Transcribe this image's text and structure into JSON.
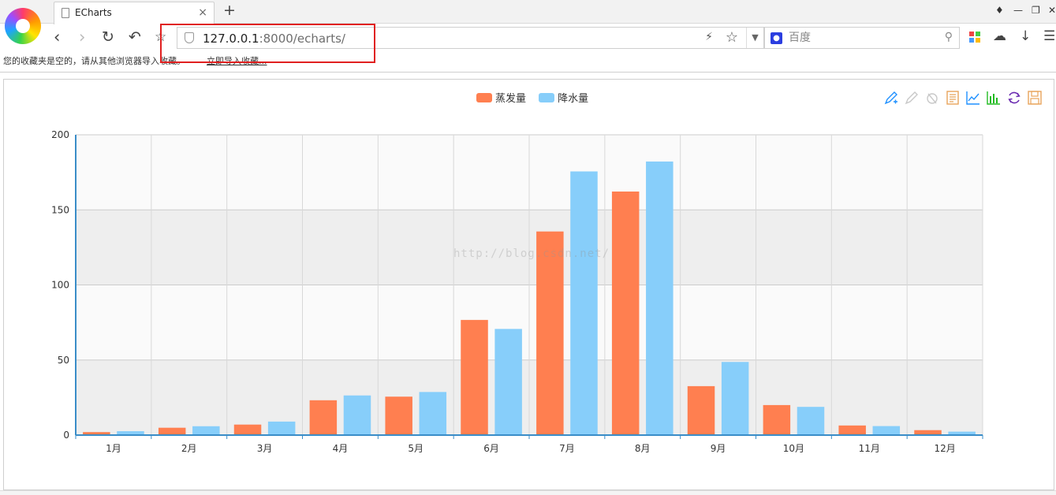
{
  "browser": {
    "tab_title": "ECharts",
    "tab_close": "×",
    "new_tab": "+",
    "url_host": "127.0.0.1",
    "url_rest": ":8000/echarts/",
    "search_placeholder": "百度",
    "search_engine_icon": "baidu-paw-icon"
  },
  "bookmarks": {
    "message": "您的收藏夹是空的，请从其他浏览器导入收藏。",
    "import_link": "立即导入收藏..."
  },
  "watermark": "http://blog.csdn.net/",
  "colors": {
    "evaporation": "#ff7f50",
    "precipitation": "#87cefa",
    "axis": "#3a8dc8",
    "highlight": "#e02020"
  },
  "chart_data": {
    "type": "bar",
    "categories": [
      "1月",
      "2月",
      "3月",
      "4月",
      "5月",
      "6月",
      "7月",
      "8月",
      "9月",
      "10月",
      "11月",
      "12月"
    ],
    "series": [
      {
        "name": "蒸发量",
        "values": [
          2.0,
          4.9,
          7.0,
          23.2,
          25.6,
          76.7,
          135.6,
          162.2,
          32.6,
          20.0,
          6.4,
          3.3
        ]
      },
      {
        "name": "降水量",
        "values": [
          2.6,
          5.9,
          9.0,
          26.4,
          28.7,
          70.7,
          175.6,
          182.2,
          48.7,
          18.8,
          6.0,
          2.3
        ]
      }
    ],
    "y_ticks": [
      "0",
      "50",
      "100",
      "150",
      "200"
    ],
    "ylim": [
      0,
      200
    ],
    "grid": true,
    "split_area": true,
    "legend_position": "top-center",
    "toolbox_position": "top-right",
    "toolbox": [
      "mark-icon",
      "mark-undo-icon",
      "mark-clear-icon",
      "data-view-icon",
      "line-chart-icon",
      "bar-chart-icon",
      "restore-icon",
      "save-image-icon"
    ]
  }
}
